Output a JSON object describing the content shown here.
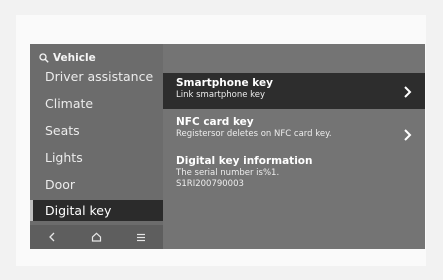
{
  "search": {
    "label": "Vehicle"
  },
  "sidebar": {
    "items": [
      {
        "label": "Driver assistance",
        "active": false
      },
      {
        "label": "Climate",
        "active": false
      },
      {
        "label": "Seats",
        "active": false
      },
      {
        "label": "Lights",
        "active": false
      },
      {
        "label": "Door",
        "active": false
      },
      {
        "label": "Digital key",
        "active": true
      }
    ]
  },
  "bottom_bar": {
    "icons": [
      "back-icon",
      "home-icon",
      "menu-icon"
    ]
  },
  "content": {
    "smartphone_key": {
      "title": "Smartphone key",
      "subtitle": "Link smartphone key"
    },
    "nfc_card_key": {
      "title": "NFC card key",
      "subtitle": "Registersor deletes on NFC card key."
    },
    "digital_key_info": {
      "title": "Digital key information",
      "line1": "The serial number is%1.",
      "line2": "S1RI200790003"
    }
  }
}
